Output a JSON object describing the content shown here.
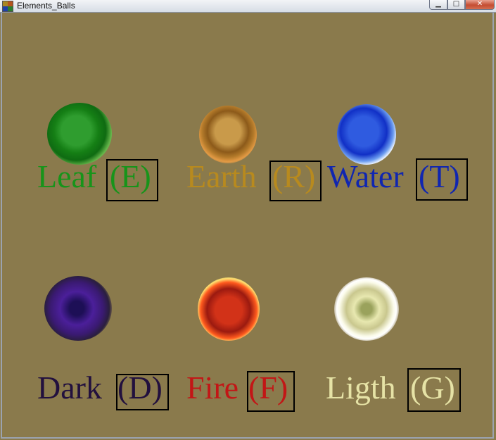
{
  "window": {
    "title": "Elements_Balls"
  },
  "elements": [
    {
      "name": "Leaf",
      "key": "(E)",
      "color": "#17941a"
    },
    {
      "name": "Earth",
      "key": "(R)",
      "color": "#b88a1e"
    },
    {
      "name": "Water",
      "key": "(T)",
      "color": "#1026b0"
    },
    {
      "name": "Dark",
      "key": "(D)",
      "color": "#22103e"
    },
    {
      "name": "Fire",
      "key": "(F)",
      "color": "#c21616"
    },
    {
      "name": "Ligth",
      "key": "(G)",
      "color": "#e6e3a6"
    }
  ],
  "colors": {
    "background": "#8a7a4c",
    "box_border": "#000000"
  }
}
